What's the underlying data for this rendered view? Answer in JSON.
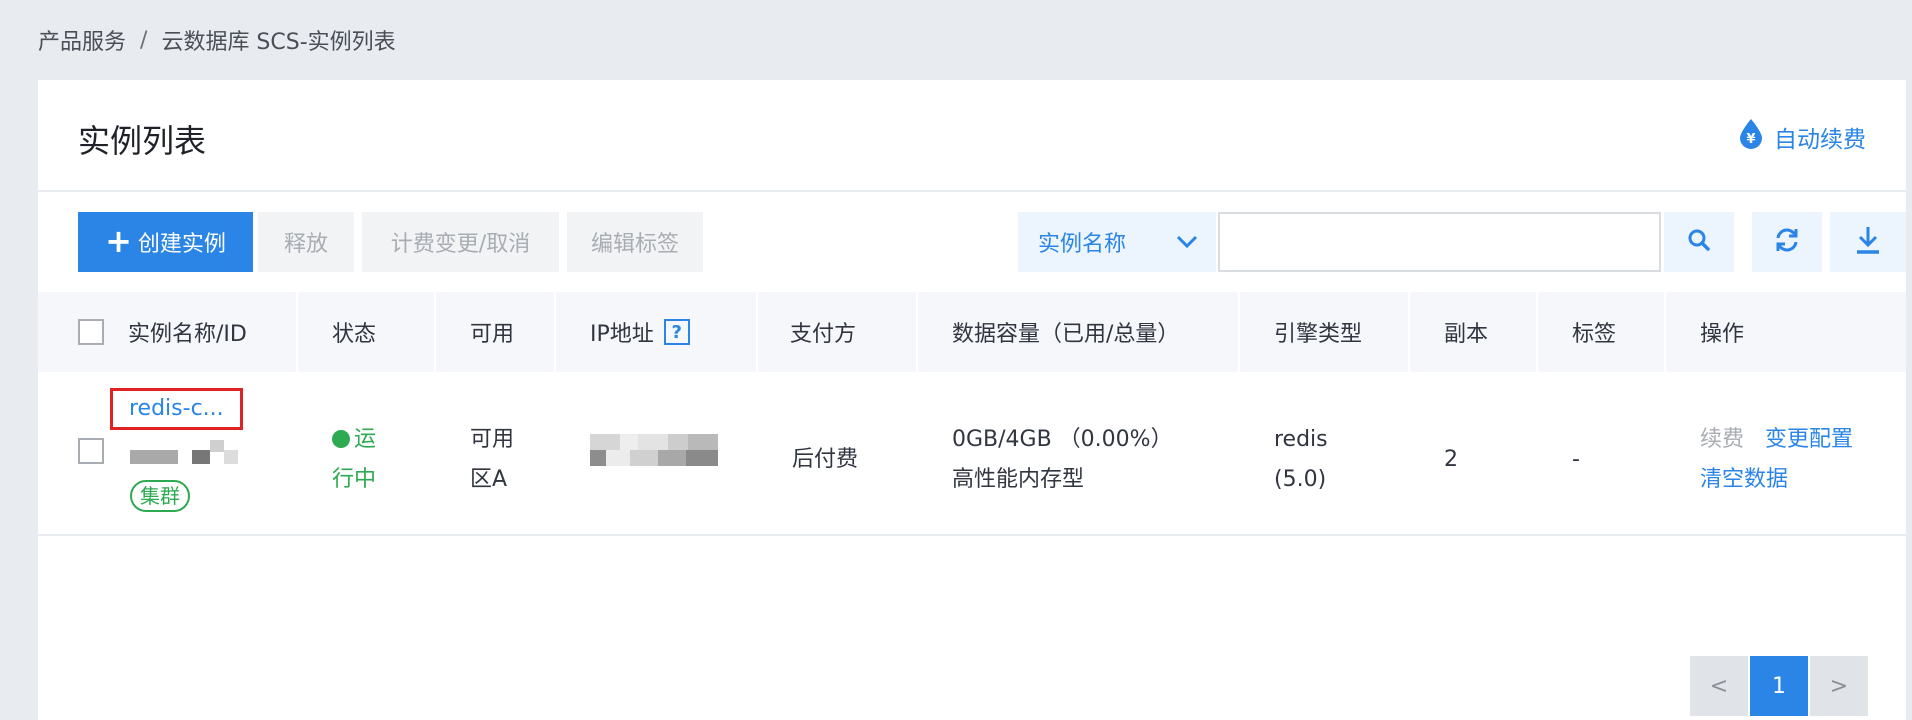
{
  "breadcrumb": {
    "root": "产品服务",
    "separator": "/",
    "current": "云数据库 SCS-实例列表"
  },
  "header": {
    "title": "实例列表",
    "auto_renew_label": "自动续费",
    "auto_renew_icon": "yen-drop-icon"
  },
  "toolbar": {
    "create_label": "创建实例",
    "release_label": "释放",
    "billing_label": "计费变更/取消",
    "tags_label": "编辑标签",
    "search_field_selected": "实例名称",
    "search_value": "",
    "search_icon": "search-icon",
    "refresh_icon": "refresh-icon",
    "download_icon": "download-icon"
  },
  "table": {
    "columns": [
      "实例名称/ID",
      "状态",
      "可用",
      "IP地址",
      "支付方",
      "数据容量（已用/总量）",
      "引擎类型",
      "副本",
      "标签",
      "操作"
    ],
    "ip_help": "?",
    "rows": [
      {
        "name": "redis-c...",
        "type_badge": "集群",
        "status_line1": "运",
        "status_line2": "行中",
        "zone_line1": "可用",
        "zone_line2": "区A",
        "payment": "后付费",
        "capacity_line1": "0GB/4GB （0.00%）",
        "capacity_line2": "高性能内存型",
        "engine_line1": "redis",
        "engine_line2": "(5.0)",
        "replicas": "2",
        "tags": "-",
        "actions": {
          "renew": "续费",
          "change_config": "变更配置",
          "clear_data": "清空数据"
        }
      }
    ]
  },
  "pagination": {
    "prev": "<",
    "current_page": "1",
    "next": ">"
  },
  "colors": {
    "primary": "#2a85e6",
    "success": "#2eaa52",
    "highlight_box": "#e02222"
  }
}
